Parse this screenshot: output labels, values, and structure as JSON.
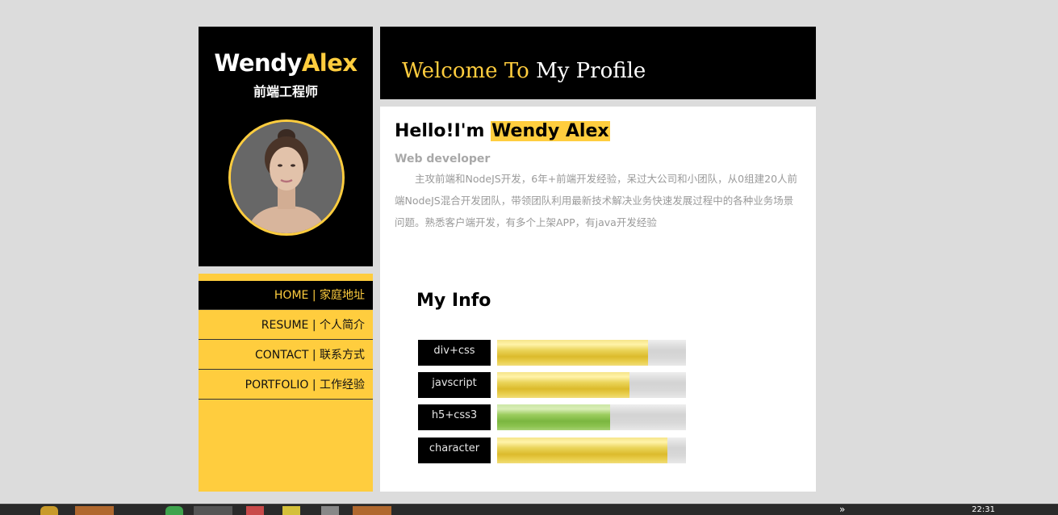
{
  "brand": {
    "first_name": "Wendy",
    "last_name": "Alex",
    "role": "前端工程师",
    "avatar": "portrait-photo"
  },
  "nav": {
    "items": [
      {
        "label": "HOME | 家庭地址",
        "active": true
      },
      {
        "label": "RESUME | 个人简介",
        "active": false
      },
      {
        "label": "CONTACT | 联系方式",
        "active": false
      },
      {
        "label": "PORTFOLIO | 工作经验",
        "active": false
      }
    ]
  },
  "header": {
    "title_part1": "Welcome To",
    "title_part2": " My Profile"
  },
  "intro": {
    "greeting": "Hello!I'm ",
    "name": "Wendy Alex",
    "subtitle": "Web developer",
    "bio": "主攻前端和NodeJS开发，6年+前端开发经验，呆过大公司和小团队，从0组建20人前端NodeJS混合开发团队，带领团队利用最新技术解决业务快速发展过程中的各种业务场景问题。熟悉客户端开发，有多个上架APP，有java开发经验"
  },
  "myinfo": {
    "title": "My Info",
    "skills": [
      {
        "label": "div+css",
        "level": 0.8,
        "color": "yellow"
      },
      {
        "label": "javscript",
        "level": 0.7,
        "color": "yellow"
      },
      {
        "label": "h5+css3",
        "level": 0.6,
        "color": "green"
      },
      {
        "label": "character",
        "level": 0.9,
        "color": "yellow"
      }
    ]
  },
  "colors": {
    "accent": "#ffcd3e",
    "background": "#dcdcdc",
    "dark": "#000000"
  },
  "taskbar": {
    "clock": "22:31",
    "overflow": "»"
  }
}
